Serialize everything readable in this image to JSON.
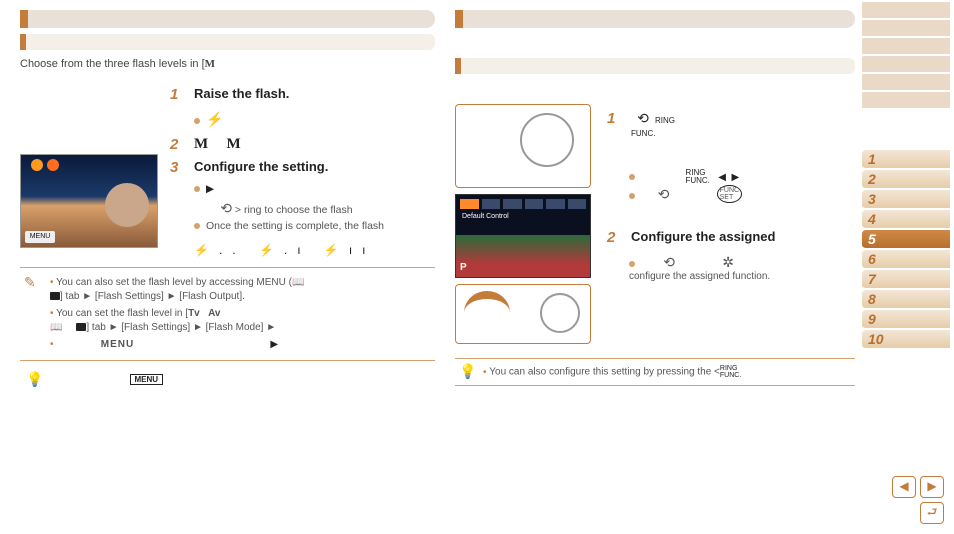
{
  "left": {
    "intro_prefix": "Choose from the three flash levels in [",
    "intro_mode": "M",
    "steps": {
      "s1_title": "Raise the flash.",
      "s1_icon": "⚡",
      "s2_mode_a": "M",
      "s2_mode_b": "M",
      "s3_title": "Configure the setting.",
      "s3_line1": "> ring to choose the flash",
      "s3_line2": "Once the setting is complete, the flash"
    },
    "photo_badge": "MENU",
    "flash_levels": "⚡..  ⚡.ı  ⚡ıı",
    "notes": {
      "n1_a": "You can also set the flash level by accessing MENU (",
      "n1_b": "] tab ► [Flash Settings] ► [Flash Output].",
      "n2_a": "You can set the flash level in [",
      "n2_tv": "Tv",
      "n2_av": "Av",
      "n2_b": "] tab ► [Flash Settings] ► [Flash Mode] ►"
    },
    "menu_word": "MENU",
    "menu_badge": "MENU"
  },
  "right": {
    "lcd_label": "Default Control",
    "lcd_p": "P",
    "ring_label_a": "RING\nFUNC.",
    "ring_label_b": "RING\nFUNC.",
    "s2_title": "Configure the assigned",
    "s2_body": "configure the assigned function.",
    "tip_a": "You can also configure this setting by pressing the <",
    "tip_label": "RING\nFUNC."
  },
  "sidebar": [
    "1",
    "2",
    "3",
    "4",
    "5",
    "6",
    "7",
    "8",
    "9",
    "10"
  ],
  "sidebar_active": 5
}
